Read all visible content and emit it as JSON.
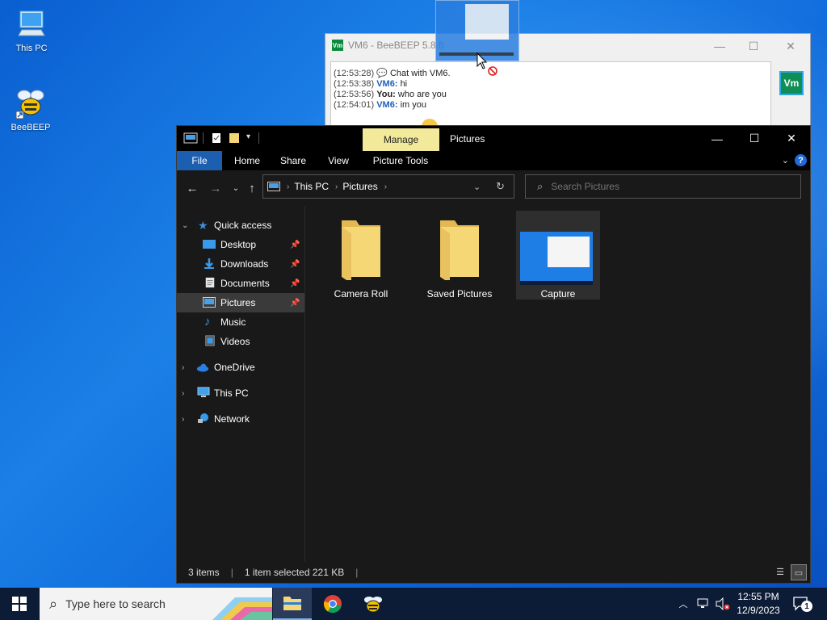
{
  "desktop": {
    "icons": [
      {
        "label": "This PC"
      },
      {
        "label": "BeeBEEP"
      }
    ]
  },
  "beebeep": {
    "title": "VM6 - BeeBEEP 5.8.6",
    "avatar": "Vm",
    "messages": [
      {
        "ts": "(12:53:28)",
        "sender": "",
        "text": "Chat with VM6."
      },
      {
        "ts": "(12:53:38)",
        "sender": "VM6:",
        "text": "hi"
      },
      {
        "ts": "(12:53:56)",
        "sender": "You:",
        "text": "who are you"
      },
      {
        "ts": "(12:54:01)",
        "sender": "VM6:",
        "text": "im you"
      }
    ]
  },
  "explorer": {
    "context_tab": "Manage",
    "title": "Pictures",
    "ribbon": {
      "file": "File",
      "home": "Home",
      "share": "Share",
      "view": "View",
      "picture_tools": "Picture Tools"
    },
    "address": {
      "crumbs": [
        "This PC",
        "Pictures"
      ]
    },
    "search": {
      "placeholder": "Search Pictures"
    },
    "nav": {
      "quick_access": "Quick access",
      "desktop": "Desktop",
      "downloads": "Downloads",
      "documents": "Documents",
      "pictures": "Pictures",
      "music": "Music",
      "videos": "Videos",
      "onedrive": "OneDrive",
      "this_pc": "This PC",
      "network": "Network"
    },
    "items": [
      {
        "name": "Camera Roll"
      },
      {
        "name": "Saved Pictures"
      },
      {
        "name": "Capture"
      }
    ],
    "status": {
      "count": "3 items",
      "selected": "1 item selected  221 KB"
    }
  },
  "taskbar": {
    "search_placeholder": "Type here to search",
    "time": "12:55 PM",
    "date": "12/9/2023",
    "notification_count": "1"
  },
  "colors": {
    "accent": "#1c5fb0",
    "manage_tab": "#f2ea9a",
    "folder": "#f6d775",
    "beebeep_green": "#0f8f55"
  }
}
